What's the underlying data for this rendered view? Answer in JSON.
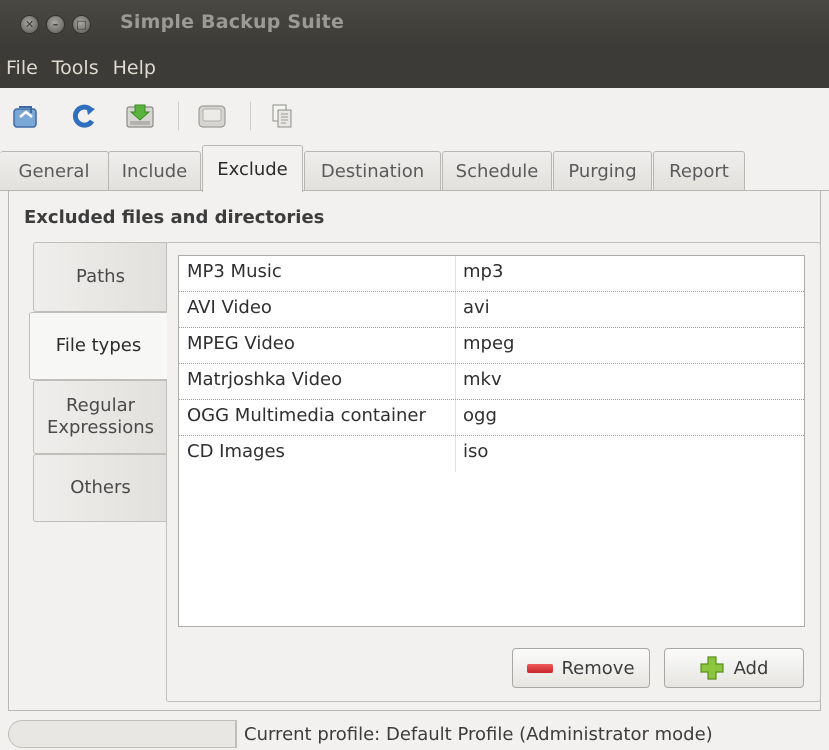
{
  "window": {
    "title": "Simple Backup Suite"
  },
  "menubar": [
    "File",
    "Tools",
    "Help"
  ],
  "toolbar": {
    "icons": [
      "backup-icon",
      "refresh-icon",
      "save-icon",
      "drive-icon",
      "copy-icon"
    ]
  },
  "tabs": [
    "General",
    "Include",
    "Exclude",
    "Destination",
    "Schedule",
    "Purging",
    "Report"
  ],
  "active_tab": "Exclude",
  "section_title": "Excluded files and directories",
  "side_tabs": [
    "Paths",
    "File types",
    "Regular Expressions",
    "Others"
  ],
  "active_side_tab": "File types",
  "file_types": [
    {
      "name": "MP3 Music",
      "ext": "mp3"
    },
    {
      "name": "AVI Video",
      "ext": "avi"
    },
    {
      "name": "MPEG Video",
      "ext": "mpeg"
    },
    {
      "name": "Matrjoshka Video",
      "ext": "mkv"
    },
    {
      "name": "OGG Multimedia container",
      "ext": "ogg"
    },
    {
      "name": "CD Images",
      "ext": "iso"
    }
  ],
  "buttons": {
    "remove": "Remove",
    "add": "Add"
  },
  "status": {
    "text": "Current profile: Default Profile  (Administrator mode)"
  }
}
